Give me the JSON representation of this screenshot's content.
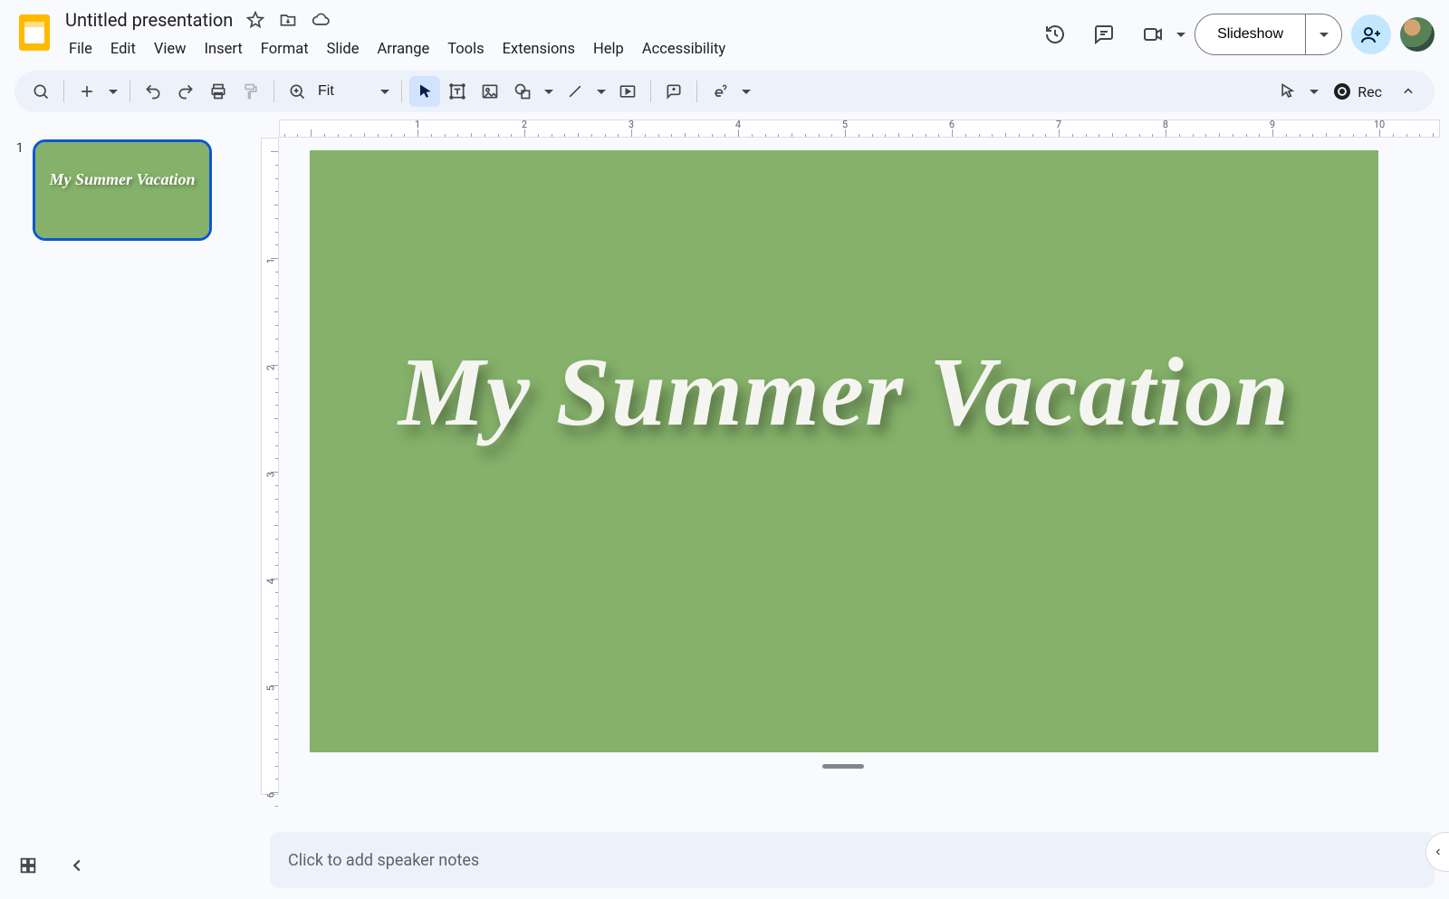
{
  "header": {
    "doc_title": "Untitled presentation",
    "menus": [
      "File",
      "Edit",
      "View",
      "Insert",
      "Format",
      "Slide",
      "Arrange",
      "Tools",
      "Extensions",
      "Help",
      "Accessibility"
    ],
    "slideshow_label": "Slideshow"
  },
  "toolbar": {
    "zoom_value": "Fit",
    "rec_label": "Rec"
  },
  "filmstrip": {
    "slides": [
      {
        "number": "1",
        "title": "My Summer Vacation"
      }
    ]
  },
  "canvas": {
    "slide_title": "My Summer Vacation",
    "ruler_h_labels": [
      "1",
      "2",
      "3",
      "4",
      "5",
      "6",
      "7",
      "8",
      "9"
    ],
    "ruler_v_labels": [
      "1",
      "2",
      "3",
      "4",
      "5"
    ]
  },
  "notes": {
    "placeholder": "Click to add speaker notes"
  },
  "colors": {
    "slide_bg": "#85b16a",
    "accent": "#0b57d0"
  }
}
